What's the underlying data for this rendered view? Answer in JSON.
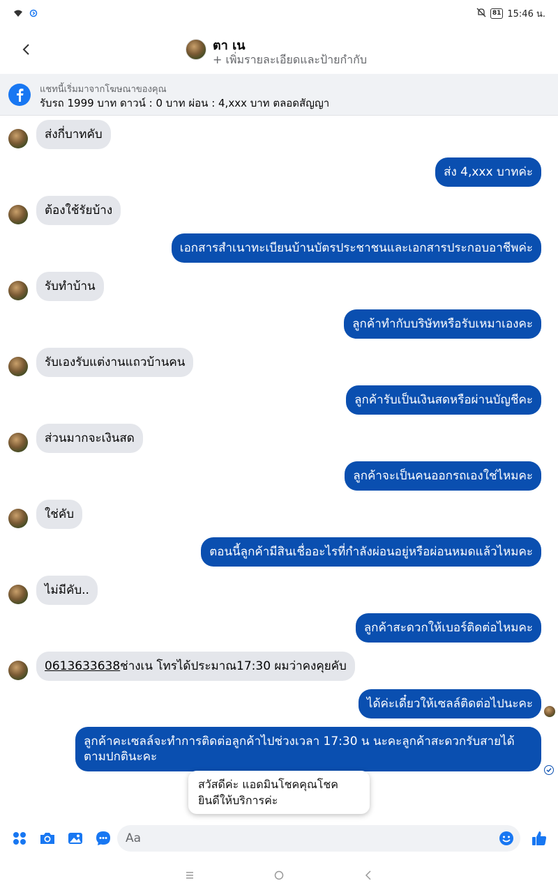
{
  "status_bar": {
    "time": "15:46 น.",
    "battery": "81",
    "icons": [
      "wifi-icon",
      "data-saver-icon",
      "mute-icon",
      "battery-icon"
    ]
  },
  "header": {
    "contact_name": "ตา เน",
    "subtitle": "+ เพิ่มรายละเอียดและป้ายกำกับ",
    "back_icon": "chevron-left-icon"
  },
  "ad_banner": {
    "title": "แชทนี้เริ่มมาจากโฆษณาของคุณ",
    "text": "รับรถ 1999 บาท ดาวน์ : 0 บาท ผ่อน : 4,xxx บาท ตลอดสัญญา"
  },
  "messages": [
    {
      "from": "in",
      "text": "ส่งกี่บาทคับ"
    },
    {
      "from": "out",
      "text": "ส่ง 4,xxx บาทค่ะ"
    },
    {
      "from": "in",
      "text": "ต้องใช้รัยบ้าง"
    },
    {
      "from": "out",
      "text": "เอกสารสำเนาทะเบียนบ้านบัตรประชาชนและเอกสารประกอบอาชีพค่ะ"
    },
    {
      "from": "in",
      "text": "รับทำบ้าน"
    },
    {
      "from": "out",
      "text": "ลูกค้าทำกับบริษัทหรือรับเหมาเองคะ"
    },
    {
      "from": "in",
      "text": "รับเองรับแต่งานแถวบ้านคน"
    },
    {
      "from": "out",
      "text": "ลูกค้ารับเป็นเงินสดหรือผ่านบัญชีคะ"
    },
    {
      "from": "in",
      "text": "ส่วนมากจะเงินสด"
    },
    {
      "from": "out",
      "text": "ลูกค้าจะเป็นคนออกรถเองใช่ไหมคะ"
    },
    {
      "from": "in",
      "text": "ใช่คับ"
    },
    {
      "from": "out",
      "text": "ตอนนี้ลูกค้ามีสินเชื่ออะไรที่กำลังผ่อนอยู่หรือผ่อนหมดแล้วไหมคะ"
    },
    {
      "from": "in",
      "text": "ไม่มีคับ.."
    },
    {
      "from": "out",
      "text": "ลูกค้าสะดวกให้เบอร์ติดต่อไหมคะ"
    },
    {
      "from": "in",
      "phone": "0613633638",
      "text": "ช่างเน  โทรได้ประมาณ17:30 ผมว่าคงคุยคับ"
    },
    {
      "from": "out",
      "text": "ได้ค่ะเดี๋ยวให้เซลล์ติดต่อไปนะคะ"
    },
    {
      "from": "out",
      "text": "ลูกค้าคะเซลล์จะทำการติดต่อลูกค้าไปช่วงเวลา 17:30 น นะคะลูกค้าสะดวกรับสายได้ตามปกตินะคะ"
    }
  ],
  "quick_reply_popup": {
    "text": "สวัสดีค่ะ แอดมินโชคคุณโชค ยินดีให้บริการค่ะ"
  },
  "composer": {
    "placeholder": "Aa",
    "icons": [
      "apps-icon",
      "camera-icon",
      "gallery-icon",
      "messenger-icon",
      "emoji-icon",
      "like-icon"
    ]
  },
  "colors": {
    "outgoing_bubble": "#0a4fb0",
    "incoming_bubble": "#e4e6eb",
    "accent": "#1877f2"
  }
}
